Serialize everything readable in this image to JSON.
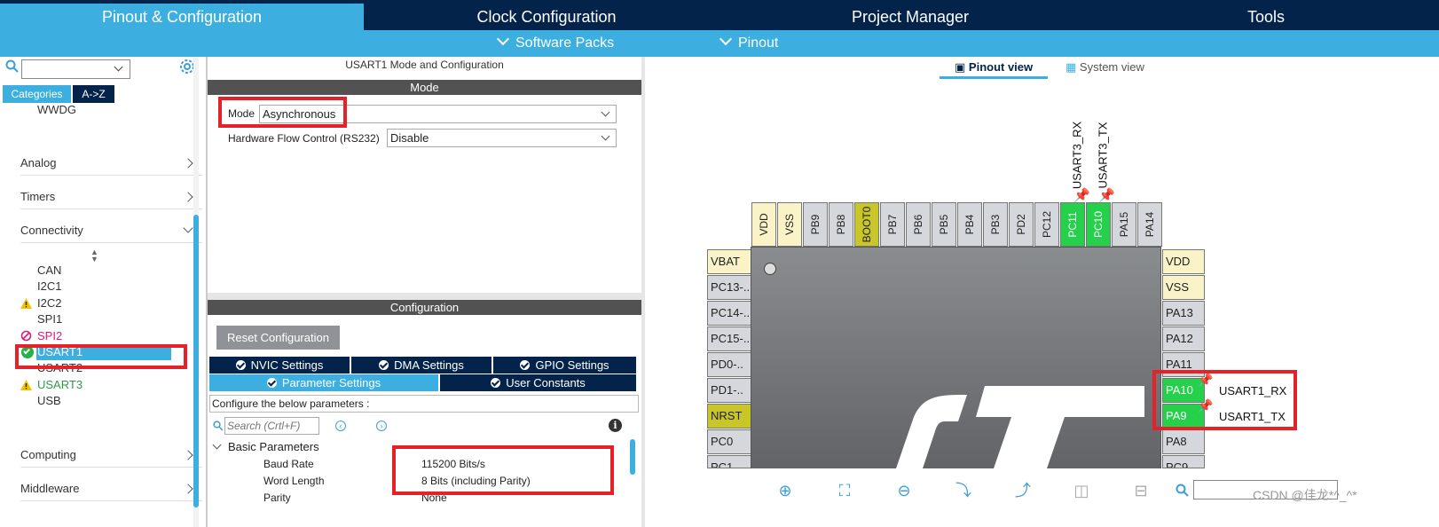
{
  "tabs": [
    "Pinout & Configuration",
    "Clock Configuration",
    "Project Manager",
    "Tools"
  ],
  "subbar": {
    "software_packs": "Software Packs",
    "pinout": "Pinout"
  },
  "left": {
    "category_tabs": [
      "Categories",
      "A->Z"
    ],
    "wwdg": "WWDG",
    "groups": {
      "analog": "Analog",
      "timers": "Timers",
      "connectivity": "Connectivity",
      "computing": "Computing",
      "middleware": "Middleware"
    },
    "items": [
      {
        "label": "CAN",
        "status": "none"
      },
      {
        "label": "I2C1",
        "status": "none"
      },
      {
        "label": "I2C2",
        "status": "warning"
      },
      {
        "label": "SPI1",
        "status": "none"
      },
      {
        "label": "SPI2",
        "status": "disabled"
      },
      {
        "label": "USART1",
        "status": "enabled-selected"
      },
      {
        "label": "USART2",
        "status": "none"
      },
      {
        "label": "USART3",
        "status": "warning"
      },
      {
        "label": "USB",
        "status": "none"
      }
    ]
  },
  "mid": {
    "title": "USART1 Mode and Configuration",
    "mode_header": "Mode",
    "mode_label": "Mode",
    "mode_value": "Asynchronous",
    "hfc_label": "Hardware Flow Control (RS232)",
    "hfc_value": "Disable",
    "config_header": "Configuration",
    "reset_button": "Reset Configuration",
    "cfg_tabs_row1": [
      "NVIC Settings",
      "DMA Settings",
      "GPIO Settings"
    ],
    "cfg_tabs_row2": [
      "Parameter Settings",
      "User Constants"
    ],
    "configure_text": "Configure the below parameters :",
    "search_placeholder": "Search (Crtl+F)",
    "basic_params": "Basic Parameters",
    "params": [
      {
        "name": "Baud Rate",
        "value": "115200 Bits/s"
      },
      {
        "name": "Word Length",
        "value": "8 Bits (including Parity)"
      },
      {
        "name": "Parity",
        "value": "None"
      }
    ]
  },
  "right": {
    "view_tabs": [
      "Pinout view",
      "System view"
    ],
    "top_pins": [
      "VDD",
      "VSS",
      "PB9",
      "PB8",
      "BOOT0",
      "PB7",
      "PB6",
      "PB5",
      "PB4",
      "PB3",
      "PD2",
      "PC12",
      "PC11",
      "PC10",
      "PA15",
      "PA14"
    ],
    "top_signals": [
      "USART3_RX",
      "USART3_TX"
    ],
    "left_pins": [
      "VBAT",
      "PC13-..",
      "PC14-..",
      "PC15-..",
      "PD0-..",
      "PD1-..",
      "NRST",
      "PC0",
      "PC1"
    ],
    "right_pins": [
      "VDD",
      "VSS",
      "PA13",
      "PA12",
      "PA11",
      "PA10",
      "PA9",
      "PA8",
      "PC9"
    ],
    "right_signals": [
      "USART1_RX",
      "USART1_TX"
    ],
    "watermark": "CSDN @佳龙*^_^*"
  },
  "colors": {
    "navy": "#03234b",
    "accent": "#3cafe0",
    "pin_green": "#25d04a",
    "highlight_red": "#e52228"
  }
}
